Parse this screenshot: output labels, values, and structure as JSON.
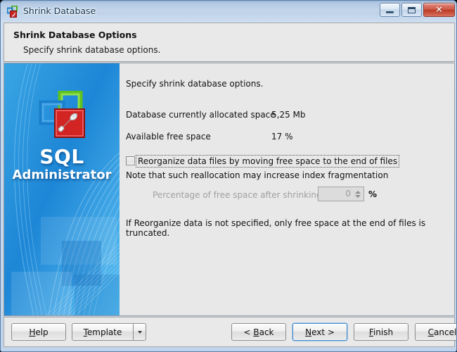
{
  "window": {
    "title": "Shrink Database",
    "icon": "database-shrink-icon",
    "controls": {
      "minimize": "minimize-icon",
      "maximize": "maximize-icon",
      "close": "close-icon",
      "close_glyph": "✕"
    }
  },
  "header": {
    "title": "Shrink Database Options",
    "subtitle": "Specify shrink database options."
  },
  "sidebar": {
    "product_name": "SQL",
    "product_sub": "Administrator",
    "logo": "sql-administrator-logo"
  },
  "content": {
    "intro": "Specify shrink database options.",
    "stats": [
      {
        "label": "Database currently allocated space",
        "value": "5,25 Mb"
      },
      {
        "label": "Available free space",
        "value": "17 %"
      }
    ],
    "reorganize_checkbox": {
      "label": "Reorganize data files by moving free space to the end of files",
      "checked": false,
      "focused": true
    },
    "note": "Note that such reallocation may increase index fragmentation",
    "percentage_field": {
      "label": "Percentage of free space after shrinking",
      "value": "0",
      "unit": "%",
      "enabled": false
    },
    "footnote": "If Reorganize data is not specified, only free space at the end of files is truncated."
  },
  "buttons": {
    "help": {
      "pre": "",
      "accel": "H",
      "post": "elp"
    },
    "template": {
      "pre": "",
      "accel": "T",
      "post": "emplate"
    },
    "back": {
      "pre": "< ",
      "accel": "B",
      "post": "ack"
    },
    "next": {
      "pre": "",
      "accel": "N",
      "post": "ext >",
      "focused": true
    },
    "finish": {
      "pre": "",
      "accel": "F",
      "post": "inish"
    },
    "cancel": {
      "pre": "",
      "accel": "C",
      "post": "ancel"
    }
  },
  "colors": {
    "accent_blue": "#1f8ddb",
    "title_text": "#123452",
    "panel_bg": "#e8e8e8",
    "close_red": "#ba3b26"
  }
}
